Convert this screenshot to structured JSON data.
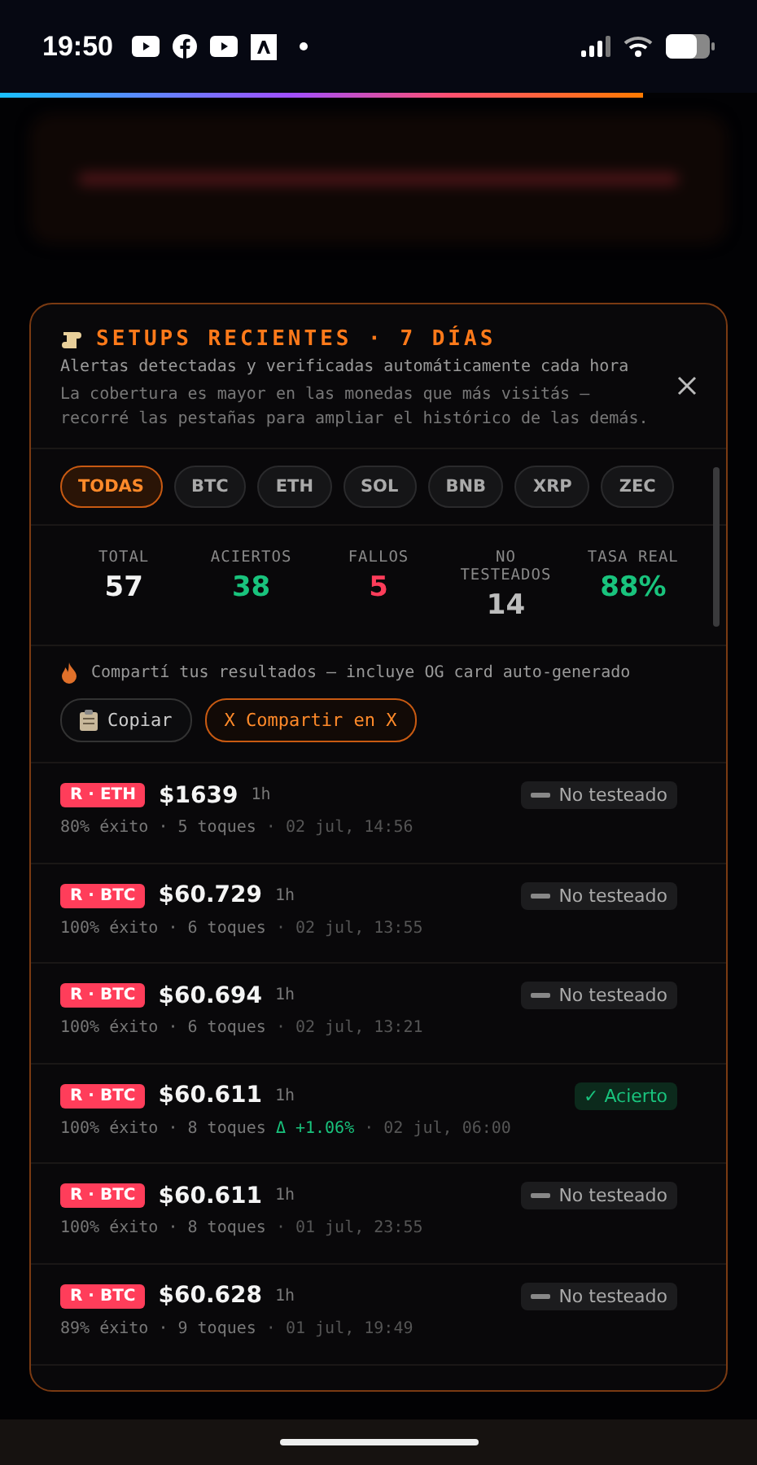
{
  "status_bar": {
    "time": "19:50"
  },
  "panel": {
    "title": "SETUPS RECIENTES · 7 DÍAS",
    "subtitle": "Alertas detectadas y verificadas automáticamente cada hora",
    "note": "La cobertura es mayor en las monedas que más visitás — recorré las pestañas para ampliar el histórico de las demás."
  },
  "tabs": [
    {
      "label": "TODAS",
      "selected": true
    },
    {
      "label": "BTC",
      "selected": false
    },
    {
      "label": "ETH",
      "selected": false
    },
    {
      "label": "SOL",
      "selected": false
    },
    {
      "label": "BNB",
      "selected": false
    },
    {
      "label": "XRP",
      "selected": false
    },
    {
      "label": "ZEC",
      "selected": false
    }
  ],
  "stats": [
    {
      "label": "TOTAL",
      "value": "57",
      "color": "#f2f2f2"
    },
    {
      "label": "ACIERTOS",
      "value": "38",
      "color": "#19c37d"
    },
    {
      "label": "FALLOS",
      "value": "5",
      "color": "#ff3d5a"
    },
    {
      "label": "NO TESTEADOS",
      "value": "14",
      "color": "#bdbdbd"
    },
    {
      "label": "TASA REAL",
      "value": "88%",
      "color": "#19c37d"
    }
  ],
  "share": {
    "text": "Compartí tus resultados — incluye OG card auto-generado",
    "buttons": [
      {
        "label": "Copiar",
        "kind": "copy"
      },
      {
        "label": "X Compartir en X",
        "kind": "primary"
      }
    ]
  },
  "setups": [
    {
      "tag": "R · ETH",
      "price": "$1639",
      "timeframe": "1h",
      "stats": "80% éxito · 5 toques",
      "date": "· 02 jul, 14:56",
      "status": "No testeado",
      "kind": "untested"
    },
    {
      "tag": "R · BTC",
      "price": "$60.729",
      "timeframe": "1h",
      "stats": "100% éxito · 6 toques",
      "date": "· 02 jul, 13:55",
      "status": "No testeado",
      "kind": "untested"
    },
    {
      "tag": "R · BTC",
      "price": "$60.694",
      "timeframe": "1h",
      "stats": "100% éxito · 6 toques",
      "date": "· 02 jul, 13:21",
      "status": "No testeado",
      "kind": "untested"
    },
    {
      "tag": "R · BTC",
      "price": "$60.611",
      "timeframe": "1h",
      "stats": "100% éxito · 8 toques",
      "delta": "Δ +1.06%",
      "date": "· 02 jul, 06:00",
      "status": "✓ Acierto",
      "kind": "hit"
    },
    {
      "tag": "R · BTC",
      "price": "$60.611",
      "timeframe": "1h",
      "stats": "100% éxito · 8 toques",
      "date": "· 01 jul, 23:55",
      "status": "No testeado",
      "kind": "untested"
    },
    {
      "tag": "R · BTC",
      "price": "$60.628",
      "timeframe": "1h",
      "stats": "89% éxito · 9 toques",
      "date": "· 01 jul, 19:49",
      "status": "No testeado",
      "kind": "untested"
    }
  ]
}
